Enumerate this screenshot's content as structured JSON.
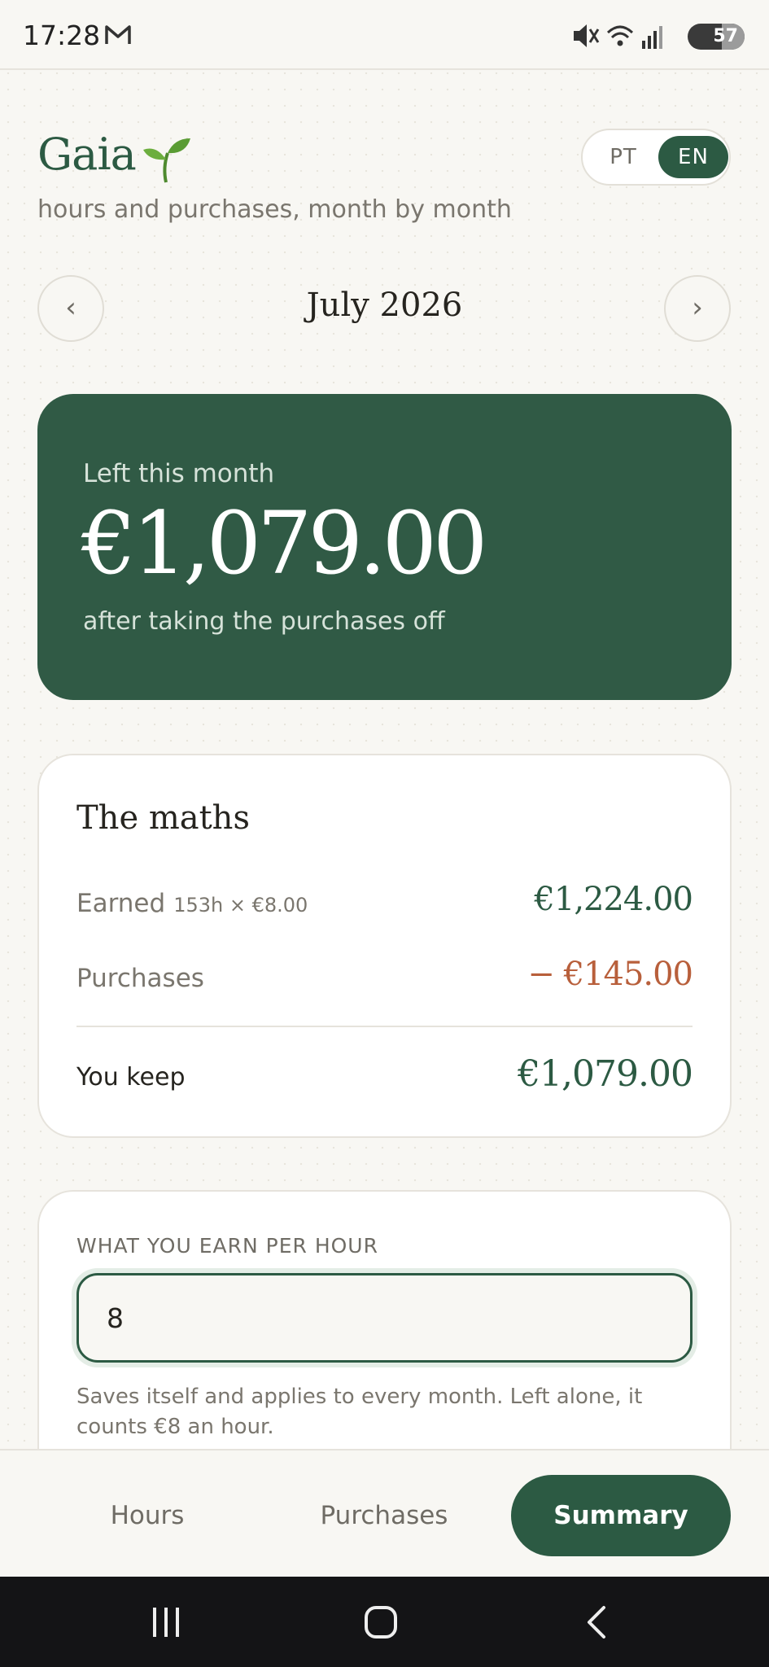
{
  "status": {
    "time": "17:28",
    "battery": "57"
  },
  "header": {
    "title": "Gaia",
    "subtitle": "hours and purchases, month by month"
  },
  "lang": {
    "pt": "PT",
    "en": "EN",
    "active": "EN"
  },
  "month": {
    "label": "July 2026",
    "prev": "‹",
    "next": "›"
  },
  "hero": {
    "label": "Left this month",
    "amount": "€1,079.00",
    "subtitle": "after taking the purchases off"
  },
  "maths": {
    "title": "The maths",
    "earned_label": "Earned",
    "earned_detail": "153h × €8.00",
    "earned_value": "€1,224.00",
    "purchases_label": "Purchases",
    "purchases_value": "− €145.00",
    "keep_label": "You keep",
    "keep_value": "€1,079.00"
  },
  "rate": {
    "label": "WHAT YOU EARN PER HOUR",
    "value": "8",
    "help": "Saves itself and applies to every month. Left alone, it counts €8 an hour."
  },
  "tabs": [
    {
      "label": "Hours",
      "active": false
    },
    {
      "label": "Purchases",
      "active": false
    },
    {
      "label": "Summary",
      "active": true
    }
  ],
  "colors": {
    "accent": "#2c5a43",
    "negative": "#b85f3b",
    "background": "#f8f7f3"
  },
  "icons": [
    "gmail-icon",
    "mute-icon",
    "wifi-icon",
    "signal-icon",
    "battery-icon",
    "sprout-icon",
    "recent-apps-icon",
    "home-icon",
    "back-icon"
  ]
}
